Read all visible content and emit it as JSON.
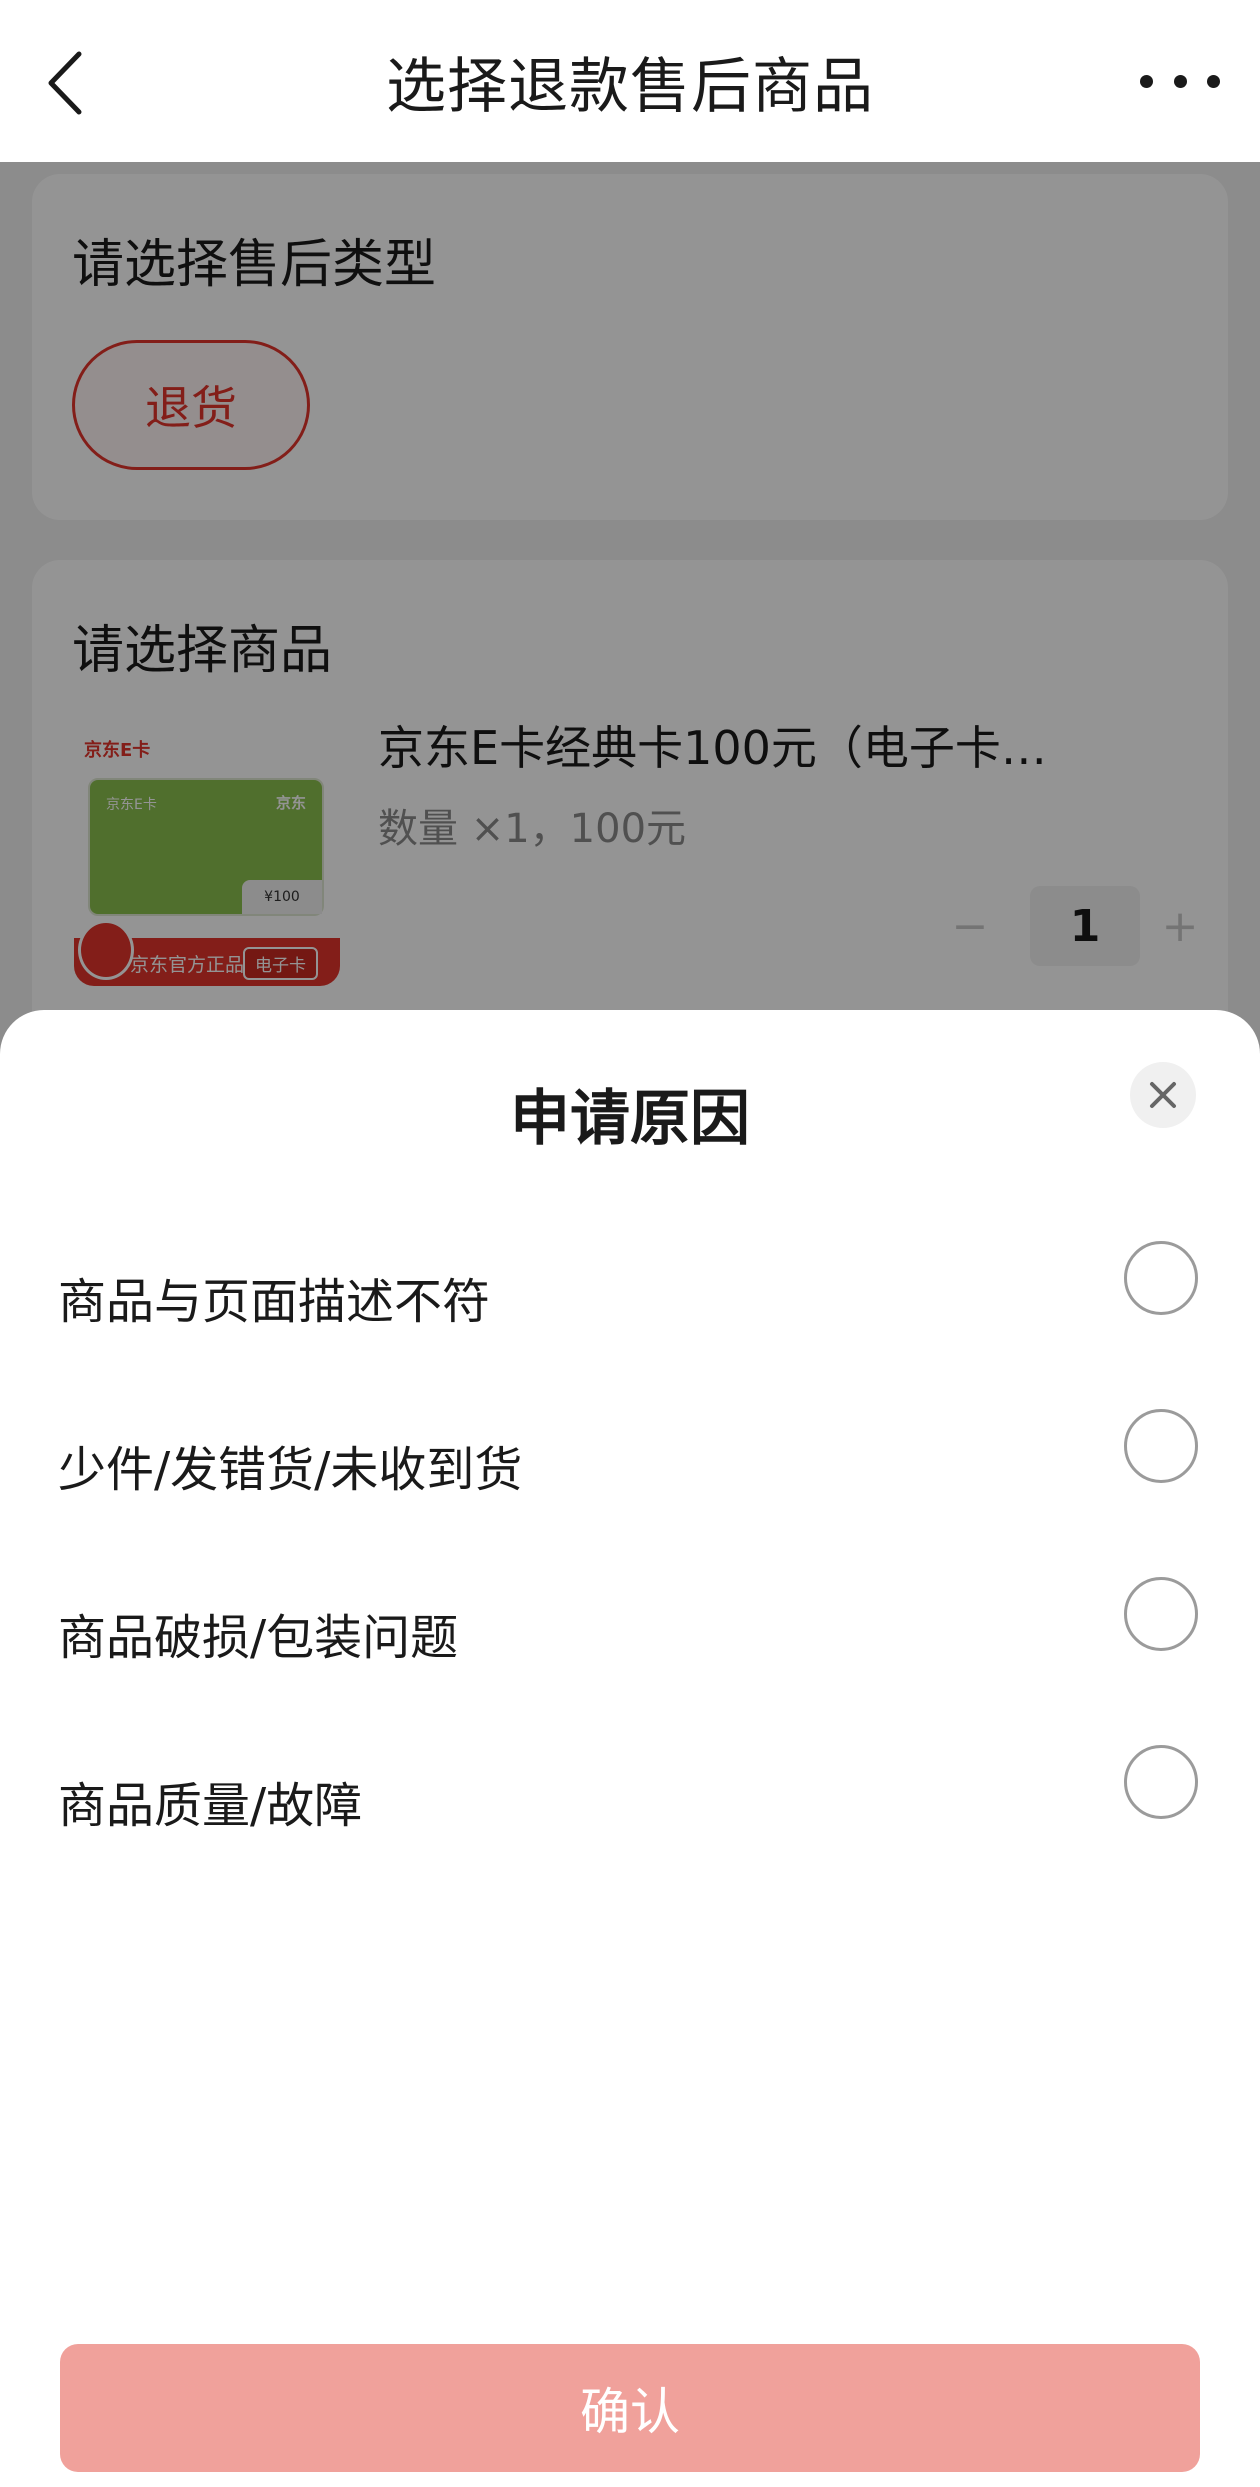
{
  "header": {
    "title": "选择退款售后商品"
  },
  "after_sale_type": {
    "heading": "请选择售后类型",
    "option": "退货"
  },
  "product_section": {
    "heading": "请选择商品",
    "product": {
      "name": "京东E卡经典卡100元（电子卡…",
      "meta": "数量 ×1，100元",
      "quantity": "1",
      "minus": "−",
      "plus": "+",
      "image": {
        "brand": "京东E卡",
        "card_left": "京东E卡",
        "card_right": "京东",
        "price": "¥100",
        "bottom_text": "京东官方正品",
        "bottom_tag": "电子卡"
      }
    }
  },
  "sheet": {
    "title": "申请原因",
    "reasons": [
      {
        "label": "商品与页面描述不符"
      },
      {
        "label": "少件/发错货/未收到货"
      },
      {
        "label": "商品破损/包装问题"
      },
      {
        "label": "商品质量/故障"
      }
    ],
    "confirm_label": "确认"
  },
  "colors": {
    "accent": "#e2342b",
    "confirm_disabled": "#f0a19b"
  }
}
